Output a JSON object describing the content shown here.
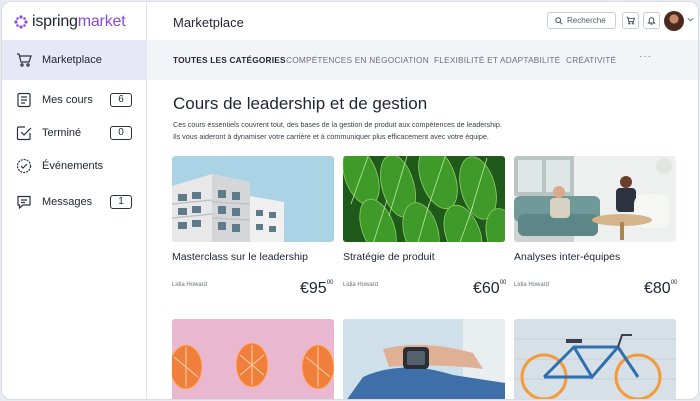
{
  "app": {
    "logo_left": "ispring",
    "logo_right": "market",
    "logo_mark_color": "#8a4ad6"
  },
  "sidebar": {
    "items": [
      {
        "label": "Marketplace",
        "icon": "cart-icon",
        "active": true
      },
      {
        "label": "Mes cours",
        "icon": "courses-icon",
        "count": "6"
      },
      {
        "label": "Terminé",
        "icon": "completed-icon",
        "count": "0"
      },
      {
        "label": "Événements",
        "icon": "events-icon"
      },
      {
        "label": "Messages",
        "icon": "messages-icon",
        "count": "1"
      }
    ]
  },
  "header": {
    "title": "Marketplace",
    "search_label": "Recherche"
  },
  "tabs": [
    {
      "label": "TOUTES LES CATÉGORIES",
      "active": true
    },
    {
      "label": "COMPÉTENCES EN NÉGOCIATION"
    },
    {
      "label": "FLEXIBILITÉ ET ADAPTABILITÉ"
    },
    {
      "label": "CRÉATIVITÉ"
    }
  ],
  "tabs_more": "···",
  "main": {
    "heading": "Cours de leadership et de gestion",
    "description_line1": "Ces cours essentiels couvrent tout, des bases de la gestion de produit aux compétences de leadership.",
    "description_line2": "Ils vous aideront à dynamiser votre carrière et à communiquer plus efficacement avec votre équipe."
  },
  "cards": [
    {
      "title": "Masterclass sur le leadership",
      "author": "Lidia Howard",
      "price": "€95",
      "cents": "00"
    },
    {
      "title": "Stratégie de produit",
      "author": "Lidia Howard",
      "price": "€60",
      "cents": "00"
    },
    {
      "title": "Analyses inter-équipes",
      "author": "Lidia Howard",
      "price": "€80",
      "cents": "00"
    }
  ]
}
